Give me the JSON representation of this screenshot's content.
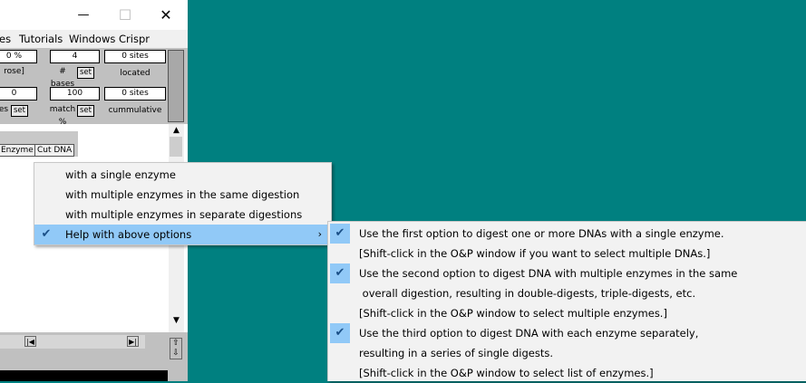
{
  "window": {
    "controls": {
      "minimize": "—",
      "maximize": "☐",
      "close": "✕"
    },
    "menus": [
      "es",
      "Tutorials",
      "Windows",
      "Crispr"
    ]
  },
  "panel": {
    "row1": [
      {
        "value": "0 %",
        "label": "rose]"
      },
      {
        "value": "4",
        "label": "# bases",
        "button": "set"
      },
      {
        "value": "0  sites",
        "label": "located"
      }
    ],
    "row2": [
      {
        "value": "0",
        "label": "es",
        "button": "set"
      },
      {
        "value": "100",
        "label": "match %",
        "button": "set"
      },
      {
        "value": "0  sites",
        "label": "cummulative"
      }
    ]
  },
  "content": {
    "buttons": [
      "Enzyme",
      "Cut DNA"
    ]
  },
  "main_menu": {
    "items": [
      {
        "label": "with a single enzyme",
        "checked": false
      },
      {
        "label": "with multiple enzymes in the same digestion",
        "checked": false
      },
      {
        "label": "with multiple enzymes in separate digestions",
        "checked": false
      },
      {
        "label": "Help with above options",
        "checked": true,
        "submenu": true
      }
    ]
  },
  "help_menu": {
    "items": [
      {
        "label": "Use the first option to digest one or more DNAs with a single enzyme.",
        "checked": true
      },
      {
        "label": "[Shift-click in the O&P window if you want to select multiple DNAs.]",
        "checked": false
      },
      {
        "label": "Use  the second option to digest DNA with multiple enzymes in the same",
        "checked": true
      },
      {
        "label": " overall digestion, resulting in double-digests, triple-digests, etc.",
        "checked": false
      },
      {
        "label": "[Shift-click in the O&P window to select multiple enzymes.]",
        "checked": false
      },
      {
        "label": "Use the third option to digest DNA with each enzyme separately,",
        "checked": true
      },
      {
        "label": "resulting in a series of single digests.",
        "checked": false
      },
      {
        "label": "[Shift-click in the O&P window to select list of enzymes.]",
        "checked": false
      }
    ]
  },
  "colors": {
    "desktop": "#008080",
    "highlight": "#91c9f7",
    "check": "#1a4f87"
  }
}
